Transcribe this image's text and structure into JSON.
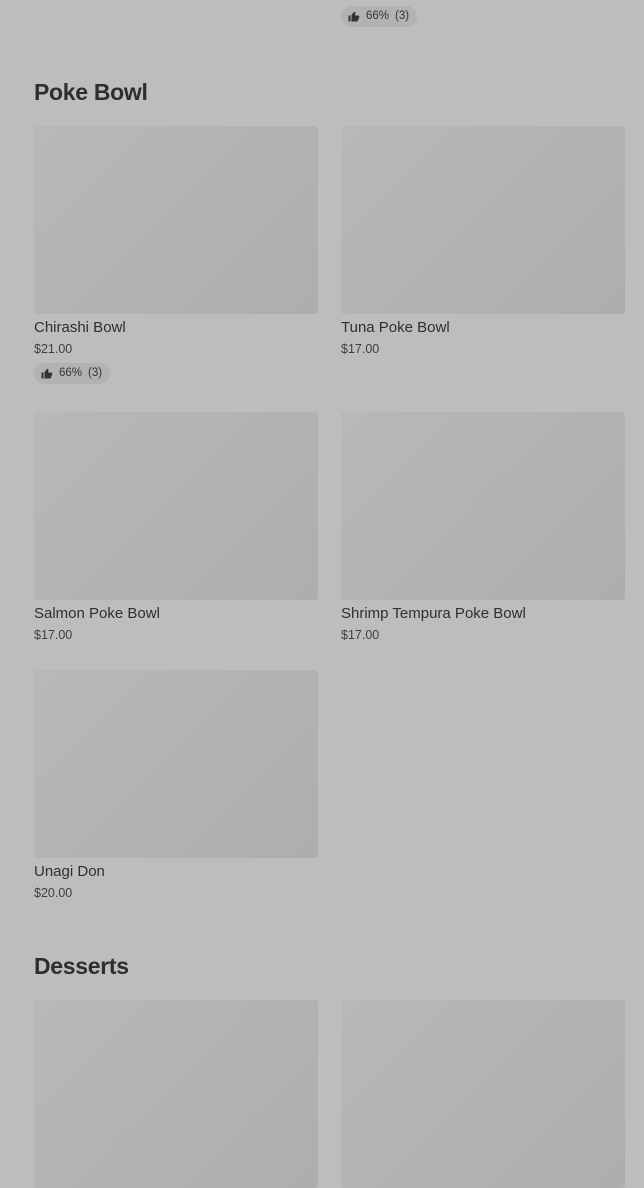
{
  "top_partial": {
    "rating": {
      "percent": "66%",
      "count": "(3)"
    }
  },
  "sections": {
    "poke_bowl": {
      "title": "Poke Bowl",
      "items": [
        {
          "name": "Chirashi Bowl",
          "price": "$21.00",
          "rating": {
            "percent": "66%",
            "count": "(3)"
          }
        },
        {
          "name": "Tuna Poke Bowl",
          "price": "$17.00"
        },
        {
          "name": "Salmon Poke Bowl",
          "price": "$17.00"
        },
        {
          "name": "Shrimp Tempura Poke Bowl",
          "price": "$17.00"
        },
        {
          "name": "Unagi Don",
          "price": "$20.00"
        }
      ]
    },
    "desserts": {
      "title": "Desserts"
    }
  },
  "icons": {
    "rating": "thumbs-up-icon"
  },
  "colors": {
    "background": "#bdbdbd",
    "image_placeholder": "#b3b3b3",
    "rating_pill": "#b2b2b2",
    "title_text": "#2e2e2e"
  }
}
